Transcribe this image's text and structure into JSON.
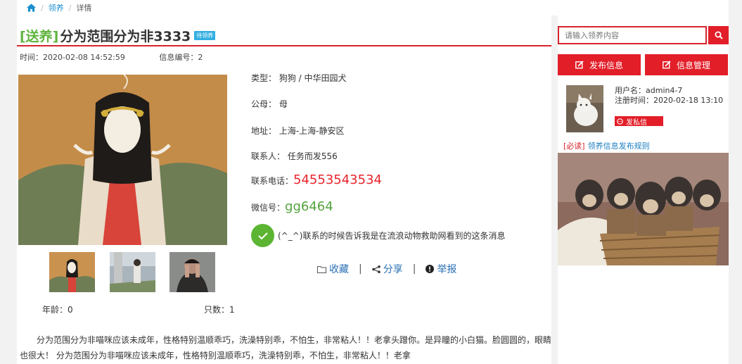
{
  "breadcrumb": {
    "item1": "领养",
    "sep1": "/",
    "sep2": "/",
    "item2": "详情"
  },
  "post": {
    "tag": "[送养]",
    "title": "分为范围分为非3333",
    "badge": "待领养",
    "time": "时间：2020-02-08 14:52:59",
    "info_id": "信息编号：2"
  },
  "details": {
    "type": "类型：  狗狗 / 中华田园犬",
    "gender": "公母：  母",
    "address": "地址：  上海-上海-静安区",
    "contact": "联系人：  任务而发556",
    "phone_label": "联系电话：",
    "phone": "54553543534",
    "wechat_label": "微信号：",
    "wechat": "gg6464",
    "notice": "(^_^)联系的时候告诉我是在流浪动物救助网看到的这条消息"
  },
  "actions": {
    "favorite": "收藏",
    "sep": "|",
    "share": "分享",
    "report": "举报"
  },
  "stats": {
    "age": "年龄：0",
    "count": "只数：1"
  },
  "description": "分为范围分为非喵咪应该未成年，性格特别温顺乖巧，洗澡特别乖，不怕生，非常粘人！！老拿头蹭你。是异瞳的小白猫。脸圆圆的，眼睛也很大！ 分为范围分为非喵咪应该未成年，性格特别温顺乖巧，洗澡特别乖，不怕生，非常粘人！！老拿",
  "sidebar": {
    "search_placeholder": "请输入领养内容",
    "publish_button": "发布信息",
    "manage_button": "信息管理",
    "username": "用户名：admin4-7",
    "register_time": "注册时间：2020-02-18 13:10",
    "message_button": "发私信",
    "rules_must": "[必读]",
    "rules_link": "领养信息发布规则"
  },
  "colors": {
    "accent_red": "#e21e28",
    "green": "#5fb43d",
    "link_blue": "#1a8fce",
    "badge_blue": "#32aee0"
  },
  "icons": [
    "home-icon",
    "search-icon",
    "edit-icon",
    "message-icon",
    "check-icon",
    "folder-icon",
    "share-icon",
    "alert-icon"
  ]
}
